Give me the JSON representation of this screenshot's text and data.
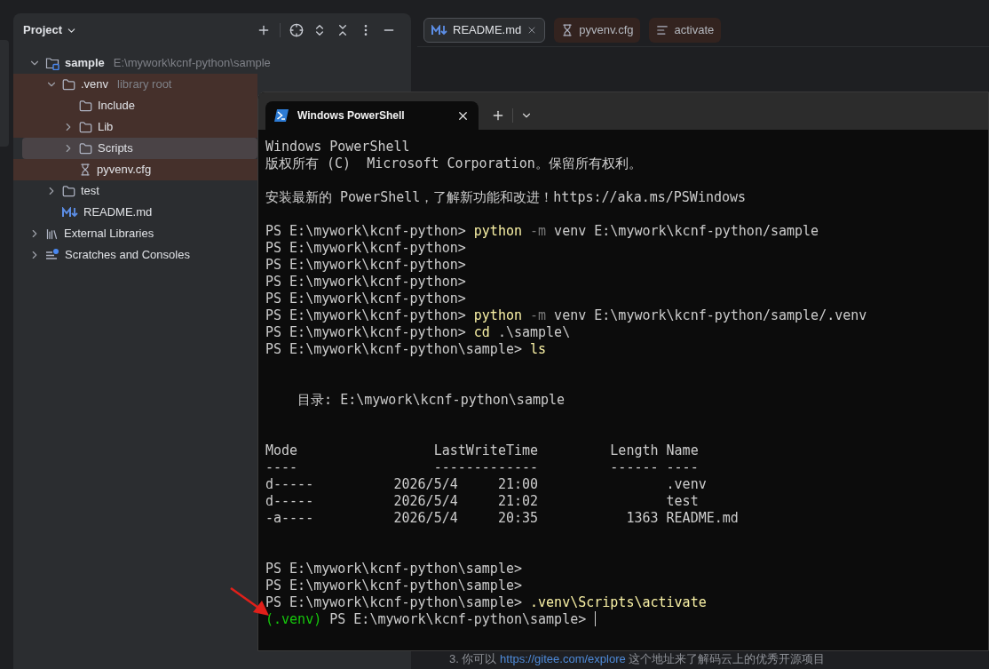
{
  "project_panel": {
    "title": "Project",
    "tree": [
      {
        "label": "sample",
        "hint": "E:\\mywork\\kcnf-python\\sample",
        "kind": "module",
        "bold": true,
        "expanded": true,
        "selected": false,
        "tint": false,
        "children": [
          {
            "label": ".venv",
            "hint": "library root",
            "kind": "folder",
            "bold": false,
            "expanded": true,
            "selected": false,
            "tint": true,
            "children": [
              {
                "label": "Include",
                "kind": "folder",
                "bold": false,
                "selected": false,
                "tint": true
              },
              {
                "label": "Lib",
                "kind": "folder",
                "bold": false,
                "expanded": false,
                "selected": false,
                "tint": true
              },
              {
                "label": "Scripts",
                "kind": "folder",
                "bold": false,
                "expanded": false,
                "selected": true,
                "tint": true
              },
              {
                "label": "pyvenv.cfg",
                "kind": "config",
                "bold": false,
                "selected": false,
                "tint": true
              }
            ]
          },
          {
            "label": "test",
            "kind": "folder",
            "bold": false,
            "expanded": false,
            "selected": false,
            "tint": false
          },
          {
            "label": "README.md",
            "kind": "markdown",
            "bold": false,
            "selected": false,
            "tint": false
          }
        ]
      },
      {
        "label": "External Libraries",
        "kind": "library",
        "bold": false,
        "expanded": false,
        "selected": false,
        "tint": false
      },
      {
        "label": "Scratches and Consoles",
        "kind": "scratches",
        "bold": false,
        "expanded": false,
        "selected": false,
        "tint": false
      }
    ]
  },
  "editor_tabs": [
    {
      "label": "README.md",
      "kind": "markdown",
      "selected": true,
      "tint": false
    },
    {
      "label": "pyvenv.cfg",
      "kind": "config",
      "selected": false,
      "tint": true
    },
    {
      "label": "activate",
      "kind": "text",
      "selected": false,
      "tint": true
    }
  ],
  "editor_line": {
    "prefix": "3. 你可以 ",
    "link": "https://gitee.com/explore",
    "suffix": " 这个地址来了解码云上的优秀开源项目"
  },
  "terminal": {
    "tab_title": "Windows PowerShell",
    "cursor": true,
    "lines": [
      {
        "kind": "text",
        "segments": [
          {
            "kind": "plain",
            "text": "Windows PowerShell"
          }
        ]
      },
      {
        "kind": "text",
        "segments": [
          {
            "kind": "plain",
            "text": "版权所有 (C)  Microsoft Corporation。保留所有权利。"
          }
        ]
      },
      {
        "kind": "blank"
      },
      {
        "kind": "text",
        "segments": [
          {
            "kind": "plain",
            "text": "安装最新的 PowerShell，了解新功能和改进！https://aka.ms/PSWindows"
          }
        ]
      },
      {
        "kind": "blank"
      },
      {
        "kind": "text",
        "segments": [
          {
            "kind": "plain",
            "text": "PS E:\\mywork\\kcnf-python> "
          },
          {
            "kind": "command",
            "text": "python"
          },
          {
            "kind": "option",
            "text": " -m"
          },
          {
            "kind": "plain",
            "text": " venv E:\\mywork\\kcnf-python/sample"
          }
        ]
      },
      {
        "kind": "text",
        "segments": [
          {
            "kind": "plain",
            "text": "PS E:\\mywork\\kcnf-python>"
          }
        ]
      },
      {
        "kind": "text",
        "segments": [
          {
            "kind": "plain",
            "text": "PS E:\\mywork\\kcnf-python>"
          }
        ]
      },
      {
        "kind": "text",
        "segments": [
          {
            "kind": "plain",
            "text": "PS E:\\mywork\\kcnf-python>"
          }
        ]
      },
      {
        "kind": "text",
        "segments": [
          {
            "kind": "plain",
            "text": "PS E:\\mywork\\kcnf-python>"
          }
        ]
      },
      {
        "kind": "text",
        "segments": [
          {
            "kind": "plain",
            "text": "PS E:\\mywork\\kcnf-python> "
          },
          {
            "kind": "command",
            "text": "python"
          },
          {
            "kind": "option",
            "text": " -m"
          },
          {
            "kind": "plain",
            "text": " venv E:\\mywork\\kcnf-python/sample/.venv"
          }
        ]
      },
      {
        "kind": "text",
        "segments": [
          {
            "kind": "plain",
            "text": "PS E:\\mywork\\kcnf-python> "
          },
          {
            "kind": "command",
            "text": "cd"
          },
          {
            "kind": "plain",
            "text": " .\\sample\\"
          }
        ]
      },
      {
        "kind": "text",
        "segments": [
          {
            "kind": "plain",
            "text": "PS E:\\mywork\\kcnf-python\\sample> "
          },
          {
            "kind": "command",
            "text": "ls"
          }
        ]
      },
      {
        "kind": "blank"
      },
      {
        "kind": "blank"
      },
      {
        "kind": "text",
        "segments": [
          {
            "kind": "plain",
            "text": "    目录: E:\\mywork\\kcnf-python\\sample"
          }
        ]
      },
      {
        "kind": "blank"
      },
      {
        "kind": "blank"
      },
      {
        "kind": "text",
        "segments": [
          {
            "kind": "plain",
            "text": "Mode                 LastWriteTime         Length Name"
          }
        ]
      },
      {
        "kind": "text",
        "segments": [
          {
            "kind": "plain",
            "text": "----                 -------------         ------ ----"
          }
        ]
      },
      {
        "kind": "text",
        "segments": [
          {
            "kind": "plain",
            "text": "d-----          2026/5/4     21:00                .venv"
          }
        ]
      },
      {
        "kind": "text",
        "segments": [
          {
            "kind": "plain",
            "text": "d-----          2026/5/4     21:02                test"
          }
        ]
      },
      {
        "kind": "text",
        "segments": [
          {
            "kind": "plain",
            "text": "-a----          2026/5/4     20:35           1363 README.md"
          }
        ]
      },
      {
        "kind": "blank"
      },
      {
        "kind": "blank"
      },
      {
        "kind": "text",
        "segments": [
          {
            "kind": "plain",
            "text": "PS E:\\mywork\\kcnf-python\\sample>"
          }
        ]
      },
      {
        "kind": "text",
        "segments": [
          {
            "kind": "plain",
            "text": "PS E:\\mywork\\kcnf-python\\sample>"
          }
        ]
      },
      {
        "kind": "text",
        "segments": [
          {
            "kind": "plain",
            "text": "PS E:\\mywork\\kcnf-python\\sample> "
          },
          {
            "kind": "command",
            "text": ".venv\\Scripts\\activate"
          }
        ]
      },
      {
        "kind": "text",
        "segments": [
          {
            "kind": "venv",
            "text": "(.venv)"
          },
          {
            "kind": "plain",
            "text": " PS E:\\mywork\\kcnf-python\\sample> "
          }
        ]
      }
    ]
  }
}
